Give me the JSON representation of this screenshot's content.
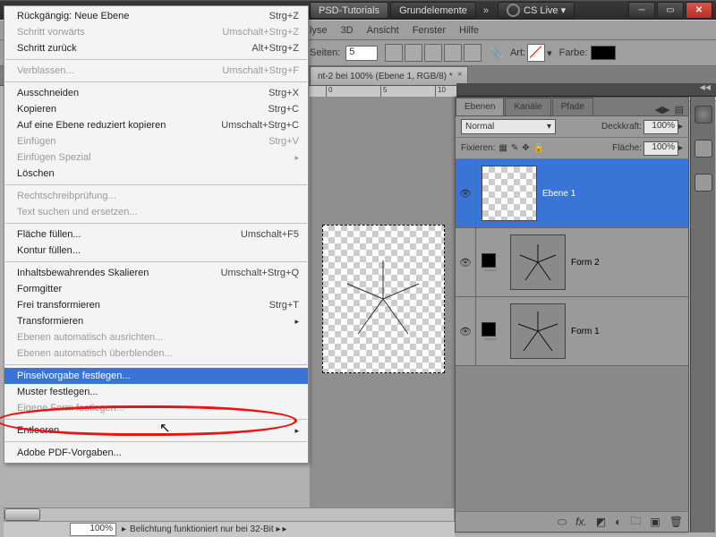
{
  "titlebar": {
    "workspaces": [
      "PSD-Tutorials",
      "Grundelemente"
    ],
    "more": "»",
    "cslive": "CS Live ▾"
  },
  "menubar": [
    "lyse",
    "3D",
    "Ansicht",
    "Fenster",
    "Hilfe"
  ],
  "optbar": {
    "seiten_label": "Seiten:",
    "seiten_value": "5",
    "art_label": "Art:",
    "farbe_label": "Farbe:"
  },
  "doctab": {
    "title": "nt-2 bei 100% (Ebene 1, RGB/8) *"
  },
  "ruler": [
    "0",
    "5",
    "10"
  ],
  "menu": [
    {
      "t": "Rückgängig: Neue Ebene",
      "sc": "Strg+Z"
    },
    {
      "t": "Schritt vorwärts",
      "sc": "Umschalt+Strg+Z",
      "dis": true
    },
    {
      "t": "Schritt zurück",
      "sc": "Alt+Strg+Z"
    },
    {
      "sep": true
    },
    {
      "t": "Verblassen...",
      "sc": "Umschalt+Strg+F",
      "dis": true
    },
    {
      "sep": true
    },
    {
      "t": "Ausschneiden",
      "sc": "Strg+X"
    },
    {
      "t": "Kopieren",
      "sc": "Strg+C"
    },
    {
      "t": "Auf eine Ebene reduziert kopieren",
      "sc": "Umschalt+Strg+C"
    },
    {
      "t": "Einfügen",
      "sc": "Strg+V",
      "dis": true
    },
    {
      "t": "Einfügen Spezial",
      "sub": true,
      "dis": true
    },
    {
      "t": "Löschen"
    },
    {
      "sep": true
    },
    {
      "t": "Rechtschreibprüfung...",
      "dis": true
    },
    {
      "t": "Text suchen und ersetzen...",
      "dis": true
    },
    {
      "sep": true
    },
    {
      "t": "Fläche füllen...",
      "sc": "Umschalt+F5"
    },
    {
      "t": "Kontur füllen..."
    },
    {
      "sep": true
    },
    {
      "t": "Inhaltsbewahrendes Skalieren",
      "sc": "Umschalt+Strg+Q"
    },
    {
      "t": "Formgitter"
    },
    {
      "t": "Frei transformieren",
      "sc": "Strg+T"
    },
    {
      "t": "Transformieren",
      "sub": true
    },
    {
      "t": "Ebenen automatisch ausrichten...",
      "dis": true
    },
    {
      "t": "Ebenen automatisch überblenden...",
      "dis": true
    },
    {
      "sep": true
    },
    {
      "t": "Pinselvorgabe festlegen...",
      "hl": true
    },
    {
      "t": "Muster festlegen..."
    },
    {
      "t": "Eigene Form festlegen...",
      "dis": true
    },
    {
      "sep": true
    },
    {
      "t": "Entleeren",
      "sub": true
    },
    {
      "sep": true
    },
    {
      "t": "Adobe PDF-Vorgaben..."
    }
  ],
  "panels": {
    "tabs": [
      "Ebenen",
      "Kanäle",
      "Pfade"
    ],
    "mode": "Normal",
    "opacity_label": "Deckkraft:",
    "opacity": "100%",
    "lock_label": "Fixieren:",
    "fill_label": "Fläche:",
    "fill": "100%",
    "layers": [
      {
        "name": "Ebene 1",
        "sel": true,
        "checker": true
      },
      {
        "name": "Form 2",
        "star": true,
        "mask": true
      },
      {
        "name": "Form 1",
        "star": true,
        "mask": true
      }
    ]
  },
  "status": {
    "zoom": "100%",
    "text": "Belichtung funktioniert nur bei 32-Bit ▸"
  }
}
